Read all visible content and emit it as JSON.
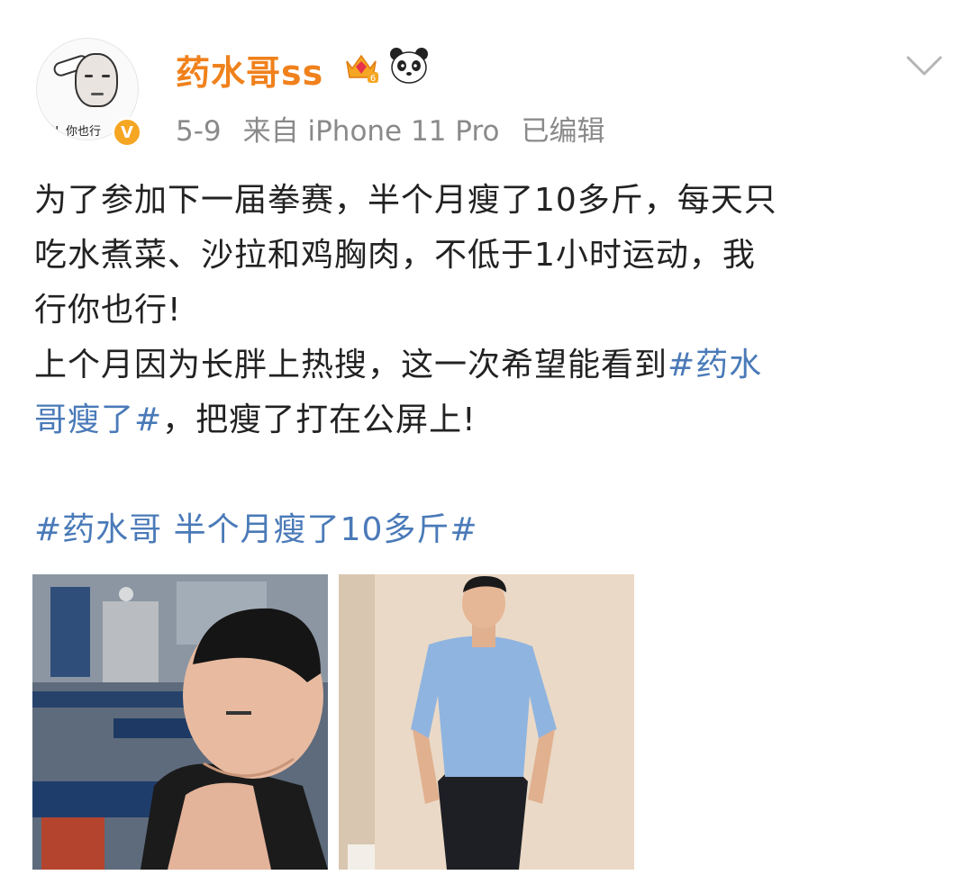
{
  "user": {
    "name": "药水哥ss",
    "avatar_caption": "行！你也行",
    "verified_symbol": "V"
  },
  "meta": {
    "date": "5-9",
    "source": "来自 iPhone 11 Pro",
    "edited": "已编辑"
  },
  "post": {
    "line1": "为了参加下一届拳赛，半个月瘦了10多斤，每天只",
    "line2": "吃水煮菜、沙拉和鸡胸肉，不低于1小时运动，我",
    "line3": "行你也行!",
    "line4_text": "上个月因为长胖上热搜，这一次希望能看到",
    "line4_tag": "#药水",
    "line5_tag": "哥瘦了#",
    "line5_text": "，把瘦了打在公屏上!",
    "topic_tag": "#药水哥 半个月瘦了10多斤#"
  },
  "icons": {
    "vip": "vip-crown-icon",
    "panda": "panda-icon",
    "more": "chevron-down-icon",
    "verified": "verified-badge-icon"
  },
  "colors": {
    "username": "#f0811c",
    "hashtag": "#4a7ab8",
    "meta": "#8a8a8a",
    "text": "#222222",
    "verified": "#f5a623"
  },
  "photos": [
    {
      "name": "gym-selfie-photo"
    },
    {
      "name": "standing-blue-shirt-photo"
    }
  ]
}
